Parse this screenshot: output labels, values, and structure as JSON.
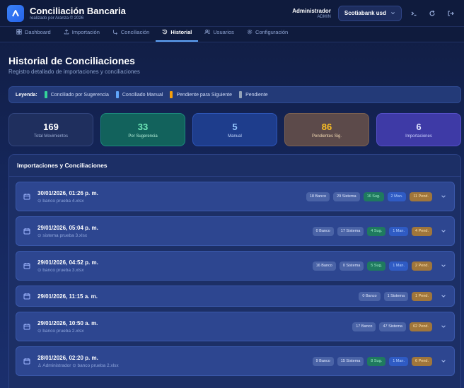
{
  "app": {
    "title": "Conciliación Bancaria",
    "subtitle": "realizado por Aranza © 2026",
    "user_name": "Administrador",
    "user_role": "ADMIN",
    "bank_selected": "Scotiabank usd"
  },
  "nav": [
    {
      "label": "Dashboard",
      "icon": "grid-icon"
    },
    {
      "label": "Importación",
      "icon": "upload-icon"
    },
    {
      "label": "Conciliación",
      "icon": "link-icon"
    },
    {
      "label": "Historial",
      "icon": "history-icon",
      "active": true
    },
    {
      "label": "Usuarios",
      "icon": "users-icon"
    },
    {
      "label": "Configuración",
      "icon": "gear-icon"
    }
  ],
  "page": {
    "title": "Historial de Conciliaciones",
    "subtitle": "Registro detallado de importaciones y conciliaciones"
  },
  "legend": {
    "title": "Leyenda:",
    "items": [
      {
        "label": "Conciliado por Sugerencia",
        "color": "#34d399"
      },
      {
        "label": "Conciliado Manual",
        "color": "#60a5fa"
      },
      {
        "label": "Pendiente para Siguiente",
        "color": "#f59e0b"
      },
      {
        "label": "Pendiente",
        "color": "#94a3b8"
      }
    ]
  },
  "stats": [
    {
      "value": "169",
      "label": "Total Movimientos"
    },
    {
      "value": "33",
      "label": "Por Sugerencia"
    },
    {
      "value": "5",
      "label": "Manual"
    },
    {
      "value": "86",
      "label": "Pendientes Sig."
    },
    {
      "value": "6",
      "label": "Importaciones"
    }
  ],
  "panel": {
    "title": "Importaciones y Conciliaciones",
    "rows": [
      {
        "date": "30/01/2026, 01:26 p. m.",
        "meta": "banco prueba 4.xlsx",
        "badges": {
          "banco": "18 Banco",
          "sistema": "29 Sistema",
          "sug": "16 Sug.",
          "man": "2 Man.",
          "pend": "11 Pend."
        }
      },
      {
        "date": "29/01/2026, 05:04 p. m.",
        "meta": "sistema prueba 3.xlsx",
        "badges": {
          "banco": "0 Banco",
          "sistema": "17 Sistema",
          "sug": "4 Sug.",
          "man": "1 Man.",
          "pend": "4 Pend."
        }
      },
      {
        "date": "29/01/2026, 04:52 p. m.",
        "meta": "banco prueba 3.xlsx",
        "badges": {
          "banco": "16 Banco",
          "sistema": "0 Sistema",
          "sug": "5 Sug.",
          "man": "1 Man.",
          "pend": "2 Pend."
        }
      },
      {
        "date": "29/01/2026, 11:15 a. m.",
        "meta": "",
        "badges": {
          "banco": "0 Banco",
          "sistema": "1 Sistema",
          "pend": "1 Pend."
        }
      },
      {
        "date": "29/01/2026, 10:50 a. m.",
        "meta": "banco prueba 2.xlsx",
        "badges": {
          "banco": "17 Banco",
          "sistema": "47 Sistema",
          "pend": "62 Pend."
        }
      },
      {
        "date": "28/01/2026, 02:20 p. m.",
        "meta_user": "Administrador",
        "meta": "banco prueba 2.xlsx",
        "badges": {
          "banco": "9 Banco",
          "sistema": "15 Sistema",
          "sug": "8 Sug.",
          "man": "1 Man.",
          "pend": "6 Pend."
        }
      }
    ]
  }
}
